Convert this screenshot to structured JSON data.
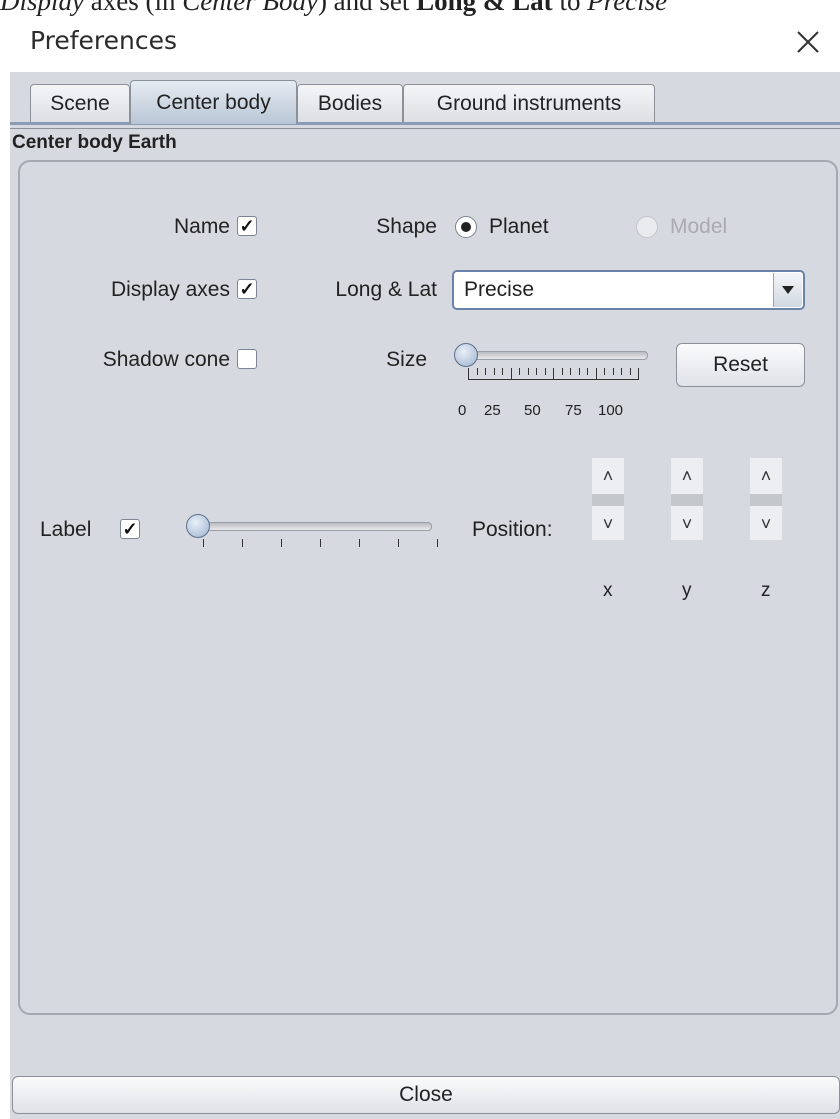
{
  "caption": {
    "part1": "Display",
    "part2": " axes (in ",
    "part3": "Center Body",
    "part4": ") and set ",
    "part5": "Long & Lat",
    "part6": " to ",
    "part7": "Precise"
  },
  "window": {
    "title": "Preferences",
    "close_glyph": "×"
  },
  "tabs": [
    {
      "label": "Scene",
      "selected": false
    },
    {
      "label": "Center body",
      "selected": true
    },
    {
      "label": "Bodies",
      "selected": false
    },
    {
      "label": "Ground instruments",
      "selected": false
    }
  ],
  "section_title": "Center body Earth",
  "form": {
    "name_label": "Name",
    "name_checked": true,
    "display_axes_label": "Display axes",
    "display_axes_checked": true,
    "shadow_cone_label": "Shadow cone",
    "shadow_cone_checked": false,
    "shape_label": "Shape",
    "shape_options": [
      {
        "label": "Planet",
        "selected": true,
        "enabled": true
      },
      {
        "label": "Model",
        "selected": false,
        "enabled": false
      }
    ],
    "long_lat_label": "Long & Lat",
    "long_lat_value": "Precise",
    "size_label": "Size",
    "size_value": 0,
    "size_ticks": [
      "0",
      "25",
      "50",
      "75",
      "100"
    ],
    "reset_label": "Reset",
    "label_label": "Label",
    "label_checked": true,
    "label_slider_value": 0,
    "position_label": "Position:",
    "axes": [
      "x",
      "y",
      "z"
    ],
    "spinner_up": "˄",
    "spinner_down": "˅"
  },
  "check_glyph": "✓",
  "close_button_label": "Close",
  "colors": {
    "panel_bg": "#d6d9df",
    "selected_tab": "#b9c6d6",
    "combo_border": "#6a83a8"
  }
}
